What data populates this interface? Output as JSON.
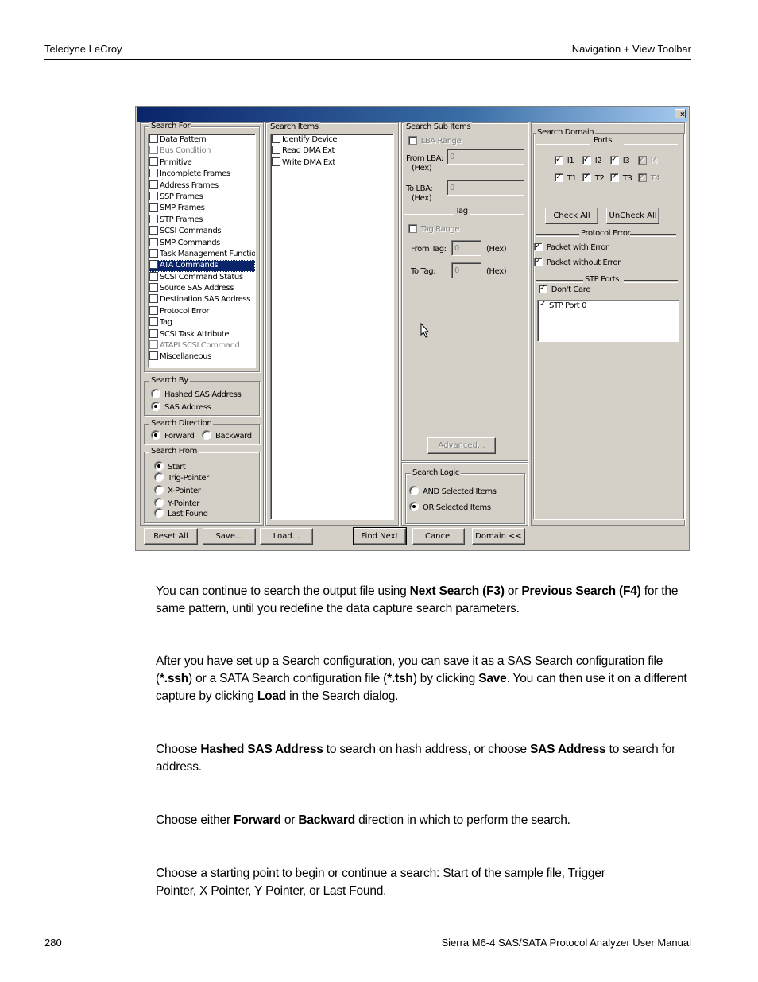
{
  "page_header": {
    "left": "Teledyne LeCroy",
    "right": "Navigation + View Toolbar"
  },
  "page_footer": {
    "page_number": "280",
    "manual_title": "Sierra M6-4 SAS/SATA Protocol Analyzer User Manual"
  },
  "dialog": {
    "close_icon": "×",
    "search_for": {
      "label": "Search For",
      "items": [
        {
          "label": "Data Pattern",
          "checked": false,
          "disabled": false,
          "selected": false
        },
        {
          "label": "Bus Condition",
          "checked": false,
          "disabled": true,
          "selected": false
        },
        {
          "label": "Primitive",
          "checked": false,
          "disabled": false,
          "selected": false
        },
        {
          "label": "Incomplete Frames",
          "checked": false,
          "disabled": false,
          "selected": false
        },
        {
          "label": "Address Frames",
          "checked": false,
          "disabled": false,
          "selected": false
        },
        {
          "label": "SSP Frames",
          "checked": false,
          "disabled": false,
          "selected": false
        },
        {
          "label": "SMP Frames",
          "checked": false,
          "disabled": false,
          "selected": false
        },
        {
          "label": "STP Frames",
          "checked": false,
          "disabled": false,
          "selected": false
        },
        {
          "label": "SCSI Commands",
          "checked": false,
          "disabled": false,
          "selected": false
        },
        {
          "label": "SMP Commands",
          "checked": false,
          "disabled": false,
          "selected": false
        },
        {
          "label": "Task Management Functions",
          "checked": false,
          "disabled": false,
          "selected": false
        },
        {
          "label": "ATA Commands",
          "checked": false,
          "disabled": false,
          "selected": true
        },
        {
          "label": "SCSI Command Status",
          "checked": false,
          "disabled": false,
          "selected": false
        },
        {
          "label": "Source SAS Address",
          "checked": false,
          "disabled": false,
          "selected": false
        },
        {
          "label": "Destination SAS Address",
          "checked": false,
          "disabled": false,
          "selected": false
        },
        {
          "label": "Protocol Error",
          "checked": false,
          "disabled": false,
          "selected": false
        },
        {
          "label": "Tag",
          "checked": false,
          "disabled": false,
          "selected": false
        },
        {
          "label": "SCSI Task Attribute",
          "checked": false,
          "disabled": false,
          "selected": false
        },
        {
          "label": "ATAPI SCSI Command",
          "checked": false,
          "disabled": true,
          "selected": false
        },
        {
          "label": "Miscellaneous",
          "checked": false,
          "disabled": false,
          "selected": false
        }
      ]
    },
    "search_by": {
      "label": "Search By",
      "options": [
        {
          "label": "Hashed SAS Address",
          "selected": false
        },
        {
          "label": "SAS Address",
          "selected": true
        }
      ]
    },
    "search_direction": {
      "label": "Search Direction",
      "options": [
        {
          "label": "Forward",
          "selected": true
        },
        {
          "label": "Backward",
          "selected": false
        }
      ]
    },
    "search_from": {
      "label": "Search From",
      "options": [
        {
          "label": "Start",
          "selected": true
        },
        {
          "label": "Trig-Pointer",
          "selected": false
        },
        {
          "label": "X-Pointer",
          "selected": false
        },
        {
          "label": "Y-Pointer",
          "selected": false
        },
        {
          "label": "Last Found",
          "selected": false
        }
      ]
    },
    "search_items": {
      "label": "Search Items",
      "items": [
        {
          "label": "Identify Device",
          "checked": false
        },
        {
          "label": "Read DMA Ext",
          "checked": false
        },
        {
          "label": "Write DMA Ext",
          "checked": false
        }
      ]
    },
    "search_sub_items": {
      "label": "Search Sub Items",
      "lba_range_label": "LBA Range",
      "from_lba_label": "From LBA:",
      "from_lba_unit": "(Hex)",
      "from_lba_value": "0",
      "to_lba_label": "To LBA:",
      "to_lba_unit": "(Hex)",
      "to_lba_value": "0",
      "tag_section_label": "Tag",
      "tag_range_label": "Tag Range",
      "from_tag_label": "From Tag:",
      "from_tag_value": "0",
      "from_tag_unit": "(Hex)",
      "to_tag_label": "To Tag:",
      "to_tag_value": "0",
      "to_tag_unit": "(Hex)",
      "advanced_button": "Advanced..."
    },
    "search_logic": {
      "label": "Search Logic",
      "options": [
        {
          "label": "AND Selected Items",
          "selected": false
        },
        {
          "label": "OR Selected Items",
          "selected": true
        }
      ]
    },
    "search_domain": {
      "label": "Search Domain",
      "ports_label": "Ports",
      "initiators": [
        {
          "label": "I1",
          "checked": true,
          "disabled": false
        },
        {
          "label": "I2",
          "checked": true,
          "disabled": false
        },
        {
          "label": "I3",
          "checked": true,
          "disabled": false
        },
        {
          "label": "I4",
          "checked": true,
          "disabled": true
        }
      ],
      "targets": [
        {
          "label": "T1",
          "checked": true,
          "disabled": false
        },
        {
          "label": "T2",
          "checked": true,
          "disabled": false
        },
        {
          "label": "T3",
          "checked": true,
          "disabled": false
        },
        {
          "label": "T4",
          "checked": true,
          "disabled": true
        }
      ],
      "check_all_button": "Check All",
      "uncheck_all_button": "UnCheck All",
      "protocol_error_label": "Protocol Error",
      "packet_with_error": {
        "label": "Packet with Error",
        "checked": true
      },
      "packet_without_error": {
        "label": "Packet without Error",
        "checked": true
      },
      "stp_ports_label": "STP Ports",
      "dont_care": {
        "label": "Don't Care",
        "checked": true
      },
      "stp_port_items": [
        {
          "label": "STP Port  0",
          "checked": true
        }
      ]
    },
    "buttons": {
      "reset_all": "Reset All",
      "save": "Save...",
      "load": "Load...",
      "find_next": "Find Next",
      "cancel": "Cancel",
      "domain": "Domain <<"
    }
  },
  "paragraphs": [
    {
      "runs": [
        {
          "t": "You can continue to search the output file using ",
          "b": false
        },
        {
          "t": "Next Search (F3)",
          "b": true
        },
        {
          "t": " or ",
          "b": false
        },
        {
          "t": "Previous Search (F4)",
          "b": true
        },
        {
          "t": " for the same pattern, until you redefine the data capture search parameters.",
          "b": false
        }
      ]
    },
    {
      "runs": [
        {
          "t": "After you have set up a Search configuration, you can save it as a SAS Search configuration file (",
          "b": false
        },
        {
          "t": "*.ssh",
          "b": true
        },
        {
          "t": ") or a SATA Search configuration file (",
          "b": false
        },
        {
          "t": "*.tsh",
          "b": true
        },
        {
          "t": ") by clicking ",
          "b": false
        },
        {
          "t": "Save",
          "b": true
        },
        {
          "t": ". You can then use it on a different capture by clicking ",
          "b": false
        },
        {
          "t": "Load",
          "b": true
        },
        {
          "t": " in the Search dialog.",
          "b": false
        }
      ]
    },
    {
      "runs": [
        {
          "t": "Choose ",
          "b": false
        },
        {
          "t": "Hashed SAS Address",
          "b": true
        },
        {
          "t": " to search on hash address, or choose ",
          "b": false
        },
        {
          "t": "SAS Address",
          "b": true
        },
        {
          "t": " to search for address.",
          "b": false
        }
      ]
    },
    {
      "runs": [
        {
          "t": "Choose either ",
          "b": false
        },
        {
          "t": "Forward",
          "b": true
        },
        {
          "t": " or ",
          "b": false
        },
        {
          "t": "Backward",
          "b": true
        },
        {
          "t": " direction in which to perform the search.",
          "b": false
        }
      ]
    },
    {
      "runs": [
        {
          "t": "Choose a starting point to begin or continue a search: Start of the sample file, Trigger Pointer, X Pointer, Y Pointer, or Last Found.",
          "b": false
        }
      ]
    }
  ]
}
